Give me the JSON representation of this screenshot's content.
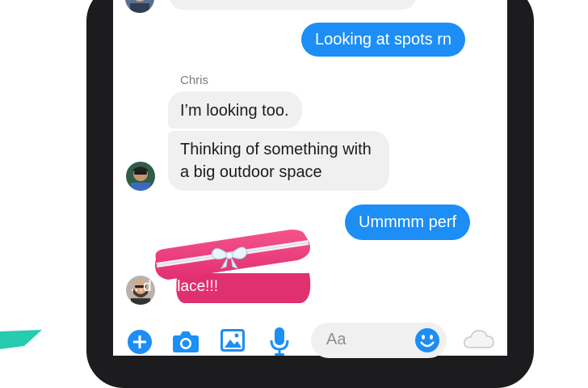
{
  "colors": {
    "accent": "#1c8ef5",
    "incoming_bubble": "#f0f0f0",
    "gift": "#ee3d7e",
    "teal_shape": "#26cbb1"
  },
  "messages": [
    {
      "direction": "outgoing",
      "text": "Looking at spots rn"
    },
    {
      "direction": "incoming",
      "sender": "Chris",
      "text": "I’m looking too."
    },
    {
      "direction": "incoming",
      "lines": [
        "Thinking of something with",
        "a big outdoor space"
      ]
    },
    {
      "direction": "outgoing",
      "text": "Ummmm perf"
    },
    {
      "direction": "incoming",
      "gift_wrapped": true,
      "partial_text": "...d a place!!!"
    }
  ],
  "composer": {
    "placeholder": "Aa",
    "icons": [
      "plus-icon",
      "camera-icon",
      "image-icon",
      "microphone-icon",
      "emoji-icon",
      "cloud-icon"
    ]
  }
}
